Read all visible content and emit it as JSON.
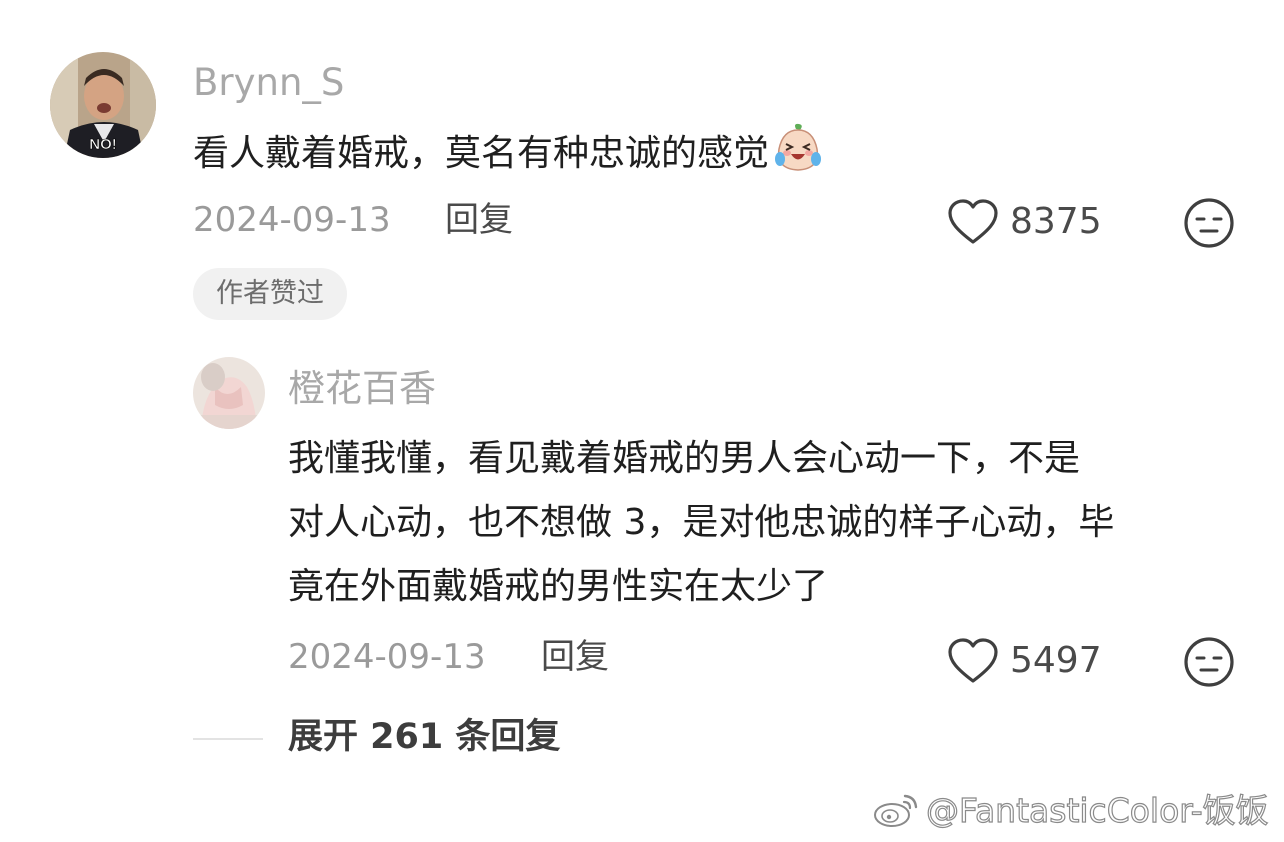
{
  "comment": {
    "username": "Brynn_S",
    "avatar_caption": "NO!",
    "text": "看人戴着婚戒，莫名有种忠诚的感觉",
    "text_emoji": "crying-laughing-emoji-icon",
    "date": "2024-09-13",
    "reply_label": "回复",
    "like_count": "8375",
    "author_badge": "作者赞过"
  },
  "reply": {
    "username": "橙花百香",
    "lines": [
      "我懂我懂，看见戴着婚戒的男人会心动一下，不是",
      "对人心动，也不想做 3，是对他忠诚的样子心动，毕",
      "竟在外面戴婚戒的男性实在太少了"
    ],
    "date": "2024-09-13",
    "reply_label": "回复",
    "like_count": "5497"
  },
  "expand": {
    "label": "展开 261 条回复"
  },
  "watermark": {
    "text": "@FantasticColor-饭饭",
    "icon": "weibo-logo-icon"
  },
  "icons": {
    "like": "heart-outline-icon",
    "reaction": "neutral-face-icon"
  },
  "colors": {
    "username": "#a8a8a8",
    "meta": "#9a9a9a",
    "badge_bg": "#f1f1f1"
  }
}
